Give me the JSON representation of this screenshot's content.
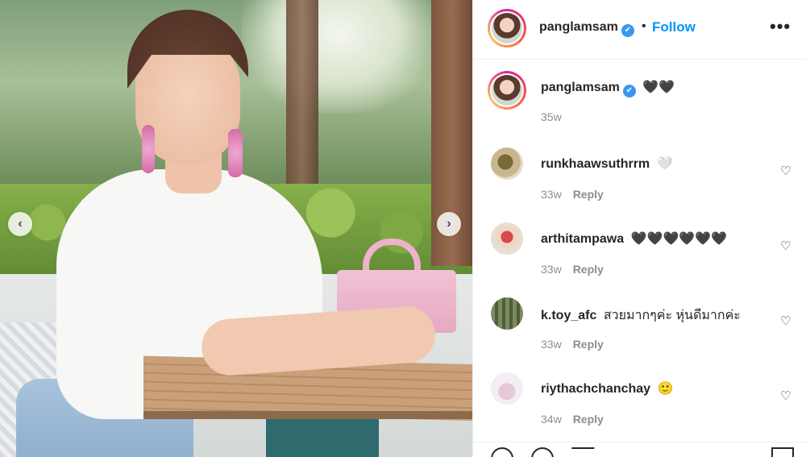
{
  "post": {
    "author": "panglamsam",
    "verified": true,
    "follow_label": "Follow",
    "separator": "•",
    "more_label": "•••"
  },
  "caption": {
    "username": "panglamsam",
    "text": "🖤🖤",
    "time": "35w"
  },
  "comments": [
    {
      "username": "runkhaawsuthrrm",
      "text": "🤍",
      "time": "33w",
      "reply_label": "Reply"
    },
    {
      "username": "arthitampawa",
      "text": "🖤🖤🖤🖤🖤🖤",
      "time": "33w",
      "reply_label": "Reply"
    },
    {
      "username": "k.toy_afc",
      "text": "สวยมากๆค่ะ หุ่นดีมากค่ะ",
      "time": "33w",
      "reply_label": "Reply"
    },
    {
      "username": "riythachchanchay",
      "text": "🙂",
      "time": "34w",
      "reply_label": "Reply"
    }
  ],
  "icons": {
    "verified": "✔",
    "heart": "♡",
    "prev": "‹",
    "next": "›"
  },
  "colors": {
    "follow": "#0095f6",
    "verified": "#3897f0",
    "meta": "#8e8e8e"
  }
}
